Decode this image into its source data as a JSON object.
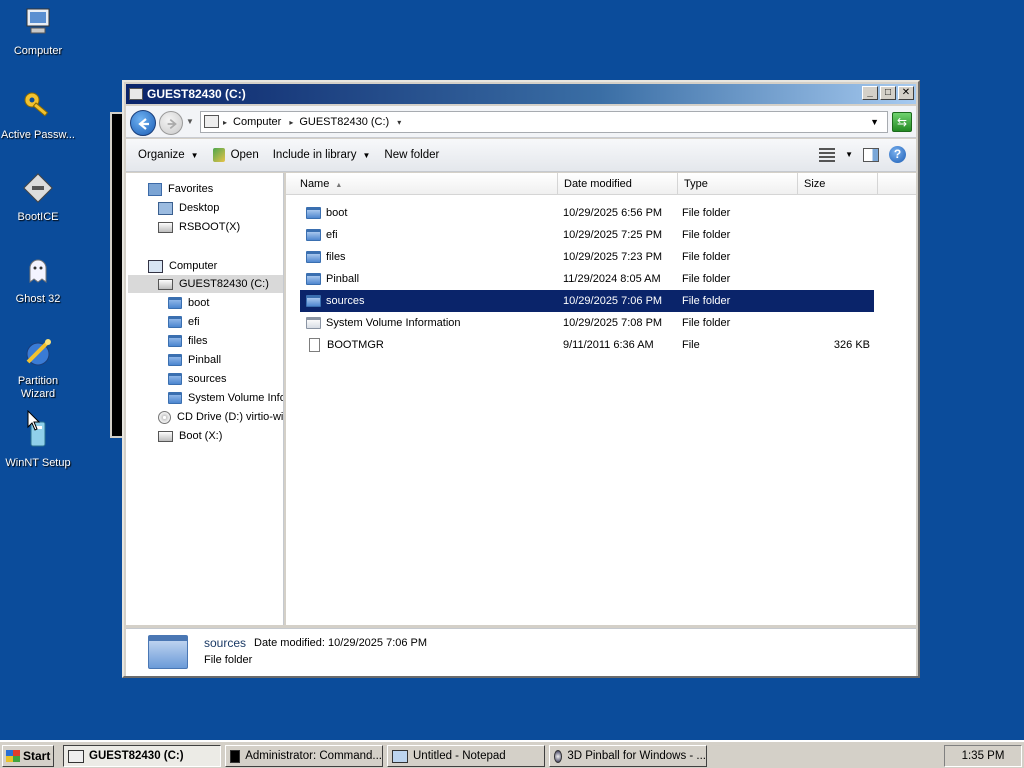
{
  "desktop": {
    "icons": [
      {
        "label": "Computer",
        "icon": "computer-icon"
      },
      {
        "label": "Active Passw...",
        "icon": "key-icon"
      },
      {
        "label": "BootICE",
        "icon": "bootice-icon"
      },
      {
        "label": "Ghost 32",
        "icon": "ghost-icon"
      },
      {
        "label": "Partition Wizard",
        "icon": "partition-wizard-icon"
      },
      {
        "label": "WinNT Setup",
        "icon": "winnt-setup-icon"
      }
    ]
  },
  "explorer": {
    "title": "GUEST82430 (C:)",
    "controls": {
      "minimize": "_",
      "maximize": "□",
      "close": "✕"
    },
    "address": {
      "crumbs": [
        "Computer",
        "GUEST82430 (C:)"
      ]
    },
    "toolbar": {
      "organize": "Organize",
      "open": "Open",
      "include_in_library": "Include in library",
      "new_folder": "New folder"
    },
    "nav": {
      "favorites": "Favorites",
      "desktop": "Desktop",
      "rsboot": "RSBOOT(X)",
      "computer": "Computer",
      "drive_c": "GUEST82430 (C:)",
      "folders": [
        "boot",
        "efi",
        "files",
        "Pinball",
        "sources",
        "System Volume Information"
      ],
      "cd_drive": "CD Drive (D:) virtio-win",
      "boot_drive": "Boot (X:)"
    },
    "columns": {
      "name": "Name",
      "date": "Date modified",
      "type": "Type",
      "size": "Size"
    },
    "files": [
      {
        "name": "boot",
        "date": "10/29/2025 6:56 PM",
        "type": "File folder",
        "size": ""
      },
      {
        "name": "efi",
        "date": "10/29/2025 7:25 PM",
        "type": "File folder",
        "size": ""
      },
      {
        "name": "files",
        "date": "10/29/2025 7:23 PM",
        "type": "File folder",
        "size": ""
      },
      {
        "name": "Pinball",
        "date": "11/29/2024 8:05 AM",
        "type": "File folder",
        "size": ""
      },
      {
        "name": "sources",
        "date": "10/29/2025 7:06 PM",
        "type": "File folder",
        "size": ""
      },
      {
        "name": "System Volume Information",
        "date": "10/29/2025 7:08 PM",
        "type": "File folder",
        "size": ""
      },
      {
        "name": "BOOTMGR",
        "date": "9/11/2011 6:36 AM",
        "type": "File",
        "size": "326 KB"
      }
    ],
    "selected_file": "sources",
    "details": {
      "name": "sources",
      "modified": "Date modified:  10/29/2025 7:06 PM",
      "type": "File folder"
    }
  },
  "taskbar": {
    "start": "Start",
    "tasks": [
      "GUEST82430 (C:)",
      "Administrator: Command...",
      "Untitled - Notepad",
      "3D Pinball for Windows - ..."
    ],
    "clock": "1:35 PM"
  },
  "colors": {
    "desktop": "#0b4c9b",
    "selection": "#0a246a",
    "titlebar": "#0a246a"
  }
}
